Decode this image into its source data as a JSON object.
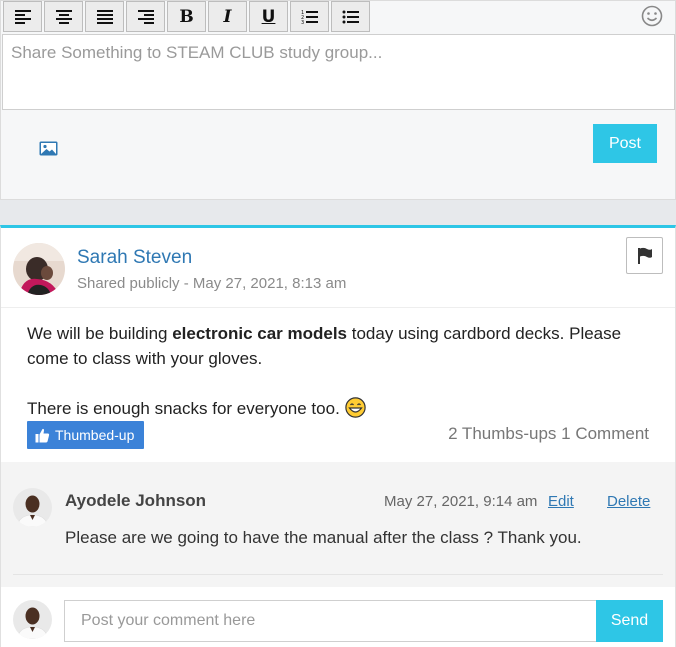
{
  "composer": {
    "toolbar": {
      "bold_label": "B",
      "italic_label": "I",
      "underline_label": "U",
      "icons": [
        "align-left-icon",
        "align-center-icon",
        "align-justify-icon",
        "align-right-icon",
        "bold-icon",
        "italic-icon",
        "underline-icon",
        "ordered-list-icon",
        "unordered-list-icon",
        "emoji-icon"
      ]
    },
    "placeholder": "Share Something to STEAM CLUB study group...",
    "post_label": "Post"
  },
  "post": {
    "author": "Sarah Steven",
    "meta": "Shared publicly - May 27, 2021, 8:13 am",
    "body_prefix": "We will be building ",
    "body_bold": "electronic car models",
    "body_suffix": " today using cardbord decks. Please come to class with your gloves.",
    "body_line2": "There is enough snacks for everyone too.",
    "thumb_label": "Thumbed-up",
    "stats": "2 Thumbs-ups 1 Comment"
  },
  "comment": {
    "author": "Ayodele Johnson",
    "time": "May 27, 2021, 9:14 am",
    "edit_label": "Edit",
    "delete_label": "Delete",
    "text": "Please are we going to have the manual after the class ? Thank you."
  },
  "reply": {
    "placeholder": "Post your comment here",
    "send_label": "Send"
  },
  "colors": {
    "accent": "#2ec6e6",
    "link": "#2f78b3",
    "thumb": "#3b82d8"
  }
}
